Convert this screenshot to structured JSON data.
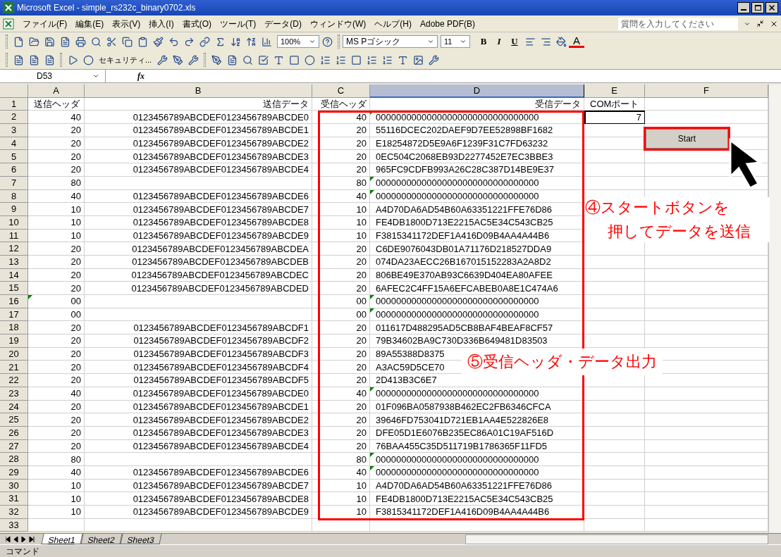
{
  "window": {
    "title": "Microsoft Excel - simple_rs232c_binary0702.xls"
  },
  "menu": [
    "ファイル(F)",
    "編集(E)",
    "表示(V)",
    "挿入(I)",
    "書式(O)",
    "ツール(T)",
    "データ(D)",
    "ウィンドウ(W)",
    "ヘルプ(H)",
    "Adobe PDF(B)"
  ],
  "help_search": {
    "placeholder": "質問を入力してください"
  },
  "toolbar": {
    "zoom": "100%",
    "font": "MS Pゴシック",
    "font_size": "11",
    "bold": "B",
    "italic": "I",
    "underline": "U",
    "font_color": "A",
    "security": "セキュリティ..."
  },
  "name_box": "D53",
  "fx": "fx",
  "columns": [
    {
      "label": "A",
      "selected": false
    },
    {
      "label": "B",
      "selected": false
    },
    {
      "label": "C",
      "selected": false
    },
    {
      "label": "D",
      "selected": true
    },
    {
      "label": "E",
      "selected": false
    },
    {
      "label": "F",
      "selected": false
    }
  ],
  "header_row": {
    "n": "1",
    "a": "送信ヘッダ",
    "b": "送信データ",
    "c": "受信ヘッダ",
    "d": "受信データ",
    "e": "COMポート"
  },
  "rows": [
    {
      "n": "2",
      "a": "40",
      "b": "0123456789ABCDEF0123456789ABCDE0",
      "c": "40",
      "d": "00000000000000000000000000000000",
      "e": "7",
      "a_warn": false,
      "d_warn": true
    },
    {
      "n": "3",
      "a": "20",
      "b": "0123456789ABCDEF0123456789ABCDE1",
      "c": "20",
      "d": "55116DCEC202DAEF9D7EE52898BF1682",
      "a_warn": false,
      "d_warn": false
    },
    {
      "n": "4",
      "a": "20",
      "b": "0123456789ABCDEF0123456789ABCDE2",
      "c": "20",
      "d": "E18254872D5E9A6F1239F31C7FD63232",
      "a_warn": false,
      "d_warn": false
    },
    {
      "n": "5",
      "a": "20",
      "b": "0123456789ABCDEF0123456789ABCDE3",
      "c": "20",
      "d": "0EC504C2068EB93D2277452E7EC3BBE3",
      "a_warn": false,
      "d_warn": false
    },
    {
      "n": "6",
      "a": "20",
      "b": "0123456789ABCDEF0123456789ABCDE4",
      "c": "20",
      "d": "965FC9CDFB993A26C28C387D14BE9E37",
      "a_warn": false,
      "d_warn": false
    },
    {
      "n": "7",
      "a": "80",
      "c": "80",
      "d": "00000000000000000000000000000000",
      "a_warn": false,
      "d_warn": true
    },
    {
      "n": "8",
      "a": "40",
      "b": "0123456789ABCDEF0123456789ABCDE6",
      "c": "40",
      "d": "00000000000000000000000000000000",
      "a_warn": false,
      "d_warn": true
    },
    {
      "n": "9",
      "a": "10",
      "b": "0123456789ABCDEF0123456789ABCDE7",
      "c": "10",
      "d": "A4D70DA6AD54B60A63351221FFE76D86",
      "a_warn": false,
      "d_warn": false
    },
    {
      "n": "10",
      "a": "10",
      "b": "0123456789ABCDEF0123456789ABCDE8",
      "c": "10",
      "d": "FE4DB1800D713E2215AC5E34C543CB25",
      "a_warn": false,
      "d_warn": false
    },
    {
      "n": "11",
      "a": "10",
      "b": "0123456789ABCDEF0123456789ABCDE9",
      "c": "10",
      "d": "F3815341172DEF1A416D09B4AA4A44B6",
      "a_warn": false,
      "d_warn": false
    },
    {
      "n": "12",
      "a": "20",
      "b": "0123456789ABCDEF0123456789ABCDEA",
      "c": "20",
      "d": "C6DE9076043DB01A71176D218527DDA9",
      "a_warn": false,
      "d_warn": false
    },
    {
      "n": "13",
      "a": "20",
      "b": "0123456789ABCDEF0123456789ABCDEB",
      "c": "20",
      "d": "074DA23AECC26B167015152283A2A8D2",
      "a_warn": false,
      "d_warn": false
    },
    {
      "n": "14",
      "a": "20",
      "b": "0123456789ABCDEF0123456789ABCDEC",
      "c": "20",
      "d": "806BE49E370AB93C6639D404EA80AFEE",
      "a_warn": false,
      "d_warn": false
    },
    {
      "n": "15",
      "a": "20",
      "b": "0123456789ABCDEF0123456789ABCDED",
      "c": "20",
      "d": "6AFEC2C4FF15A6EFCABEB0A8E1C474A6",
      "a_warn": false,
      "d_warn": false
    },
    {
      "n": "16",
      "a": "00",
      "c": "00",
      "d": "00000000000000000000000000000000",
      "a_warn": true,
      "d_warn": true
    },
    {
      "n": "17",
      "a": "00",
      "c": "00",
      "d": "00000000000000000000000000000000",
      "a_warn": false,
      "d_warn": true
    },
    {
      "n": "18",
      "a": "20",
      "b": "0123456789ABCDEF0123456789ABCDF1",
      "c": "20",
      "d": "011617D488295AD5CB8BAF4BEAF8CF57",
      "a_warn": false,
      "d_warn": false
    },
    {
      "n": "19",
      "a": "20",
      "b": "0123456789ABCDEF0123456789ABCDF2",
      "c": "20",
      "d": "79B34602BA9C730D336B649481D83503",
      "a_warn": false,
      "d_warn": false
    },
    {
      "n": "20",
      "a": "20",
      "b": "0123456789ABCDEF0123456789ABCDF3",
      "c": "20",
      "d": "89A55388D8375",
      "a_warn": false,
      "d_warn": false
    },
    {
      "n": "21",
      "a": "20",
      "b": "0123456789ABCDEF0123456789ABCDF4",
      "c": "20",
      "d": "A3AC59D5CE70",
      "a_warn": false,
      "d_warn": false
    },
    {
      "n": "22",
      "a": "20",
      "b": "0123456789ABCDEF0123456789ABCDF5",
      "c": "20",
      "d": "2D413B3C6E7",
      "a_warn": false,
      "d_warn": false
    },
    {
      "n": "23",
      "a": "40",
      "b": "0123456789ABCDEF0123456789ABCDE0",
      "c": "40",
      "d": "00000000000000000000000000000000",
      "a_warn": false,
      "d_warn": true
    },
    {
      "n": "24",
      "a": "20",
      "b": "0123456789ABCDEF0123456789ABCDE1",
      "c": "20",
      "d": "01F096BA0587938B462EC2FB6346CFCA",
      "a_warn": false,
      "d_warn": false
    },
    {
      "n": "25",
      "a": "20",
      "b": "0123456789ABCDEF0123456789ABCDE2",
      "c": "20",
      "d": "39646FD753041D721EB1AA4E522826E8",
      "a_warn": false,
      "d_warn": false
    },
    {
      "n": "26",
      "a": "20",
      "b": "0123456789ABCDEF0123456789ABCDE3",
      "c": "20",
      "d": "DFE05D1E6076B235EC86A01C19AF516D",
      "a_warn": false,
      "d_warn": false
    },
    {
      "n": "27",
      "a": "20",
      "b": "0123456789ABCDEF0123456789ABCDE4",
      "c": "20",
      "d": "76BAA455C35D511719B1786365F11FD5",
      "a_warn": false,
      "d_warn": false
    },
    {
      "n": "28",
      "a": "80",
      "c": "80",
      "d": "00000000000000000000000000000000",
      "a_warn": false,
      "d_warn": true
    },
    {
      "n": "29",
      "a": "40",
      "b": "0123456789ABCDEF0123456789ABCDE6",
      "c": "40",
      "d": "00000000000000000000000000000000",
      "a_warn": false,
      "d_warn": true
    },
    {
      "n": "30",
      "a": "10",
      "b": "0123456789ABCDEF0123456789ABCDE7",
      "c": "10",
      "d": "A4D70DA6AD54B60A63351221FFE76D86",
      "a_warn": false,
      "d_warn": false
    },
    {
      "n": "31",
      "a": "10",
      "b": "0123456789ABCDEF0123456789ABCDE8",
      "c": "10",
      "d": "FE4DB1800D713E2215AC5E34C543CB25",
      "a_warn": false,
      "d_warn": false
    },
    {
      "n": "32",
      "a": "10",
      "b": "0123456789ABCDEF0123456789ABCDE9",
      "c": "10",
      "d": "F3815341172DEF1A416D09B4AA4A44B6",
      "a_warn": false,
      "d_warn": false
    },
    {
      "n": "33"
    }
  ],
  "start_button": "Start",
  "annotations": [
    {
      "lines": [
        "④スタートボタンを",
        "押してデータを送信"
      ]
    },
    {
      "lines": [
        "⑤受信ヘッダ・データ出力"
      ]
    }
  ],
  "sheet_tabs": [
    {
      "label": "Sheet1",
      "selected": true
    },
    {
      "label": "Sheet2",
      "selected": false
    },
    {
      "label": "Sheet3",
      "selected": false
    }
  ],
  "status_bar": "コマンド"
}
